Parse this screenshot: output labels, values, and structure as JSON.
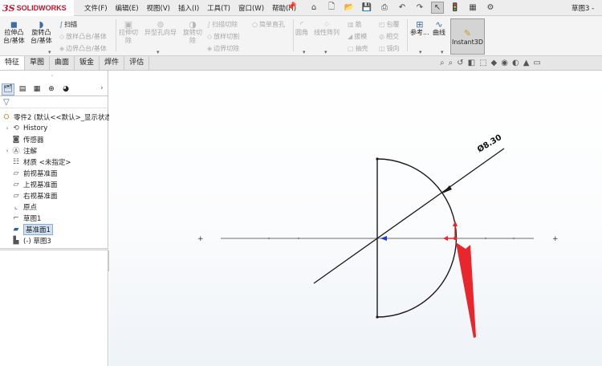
{
  "app": {
    "logo_ds": "3S",
    "logo_name": "SOLIDWORKS",
    "document_title": "草图3 -"
  },
  "menu": [
    "文件(F)",
    "编辑(E)",
    "视图(V)",
    "插入(I)",
    "工具(T)",
    "窗口(W)",
    "帮助(H)"
  ],
  "ribbon": {
    "extrude_boss": "拉伸凸\n台/基体",
    "revolve_boss": "旋转凸\n台/基体",
    "sweep": "扫描",
    "loft_boss": "放样凸台/基体",
    "boundary_boss": "边界凸台/基体",
    "extrude_cut": "拉伸切\n除",
    "hole_wizard": "异型孔向导",
    "revolve_cut": "旋转切\n除",
    "swept_cut": "扫描切除",
    "lofted_cut": "放样切割",
    "boundary_cut": "边界切除",
    "simple_hole": "简单直孔",
    "fillet": "圆角",
    "linear_pattern": "线性阵列",
    "rib": "筋",
    "draft": "拔模",
    "shell": "抽壳",
    "wrap": "包覆",
    "intersect": "相交",
    "mirror": "镜向",
    "ref_geometry": "参考...",
    "curves": "曲线",
    "instant3d": "Instant3D"
  },
  "tabs": [
    "特征",
    "草图",
    "曲面",
    "钣金",
    "焊件",
    "评估"
  ],
  "tree": {
    "root": "零件2 (默认<<默认>_显示状态",
    "history": "History",
    "sensors": "传感器",
    "annotations": "注解",
    "material": "材质 <未指定>",
    "front_plane": "前视基准面",
    "top_plane": "上视基准面",
    "right_plane": "右视基准面",
    "origin": "原点",
    "sketch1": "草图1",
    "plane1": "基准面1",
    "sketch3": "(-) 草图3"
  },
  "sketch": {
    "dimension": "Ø8.30",
    "line_color": "#1a1a1a",
    "arrow_color": "#e8262b",
    "axis_color": "#8a8a8a",
    "origin_color": "#1e3cc8"
  }
}
